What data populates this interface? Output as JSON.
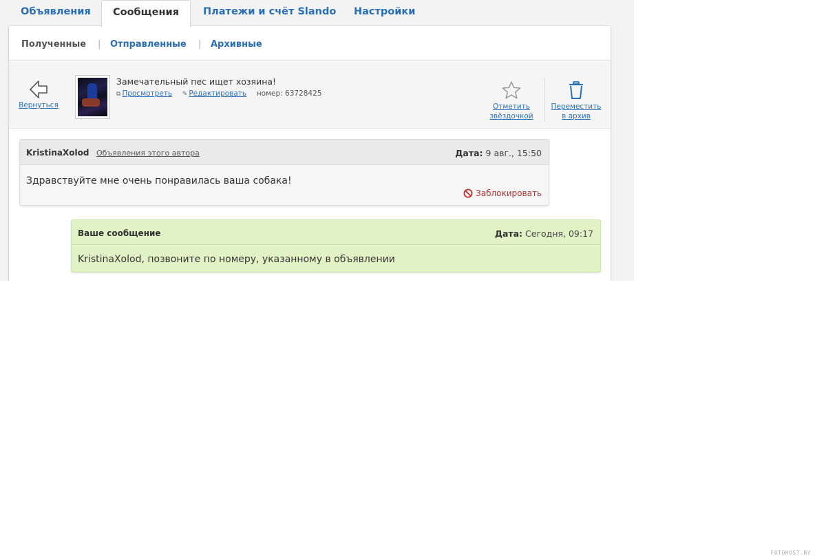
{
  "tabs": [
    {
      "label": "Объявления"
    },
    {
      "label": "Сообщения"
    },
    {
      "label": "Платежи и счёт Slando"
    },
    {
      "label": "Настройки"
    }
  ],
  "subnav": {
    "received": "Полученные",
    "sent": "Отправленные",
    "archived": "Архивные",
    "separator": "|"
  },
  "ad": {
    "back_label": "Вернуться",
    "title": "Замечательный пес ищет хозяина!",
    "view_label": "Просмотреть",
    "edit_label": "Редактировать",
    "number_text": "номер: 63728425",
    "star_label_1": "Отметить",
    "star_label_2": "звёздочкой",
    "archive_label_1": "Переместить",
    "archive_label_2": "в архив"
  },
  "messages": {
    "incoming": {
      "author": "KristinaXolod",
      "author_ads_link": "Объявления этого автора",
      "date_label": "Дата:",
      "date_value": "9 авг., 15:50",
      "text": "Здравствуйте мне очень понравилась ваша собака!",
      "block_label": "Заблокировать"
    },
    "outgoing": {
      "author": "Ваше сообщение",
      "date_label": "Дата:",
      "date_value": "Сегодня, 09:17",
      "text": "KristinaXolod, позвоните по номеру, указанному в объявлении"
    }
  },
  "watermark": "FOTOHOST.BY",
  "colors": {
    "link": "#2a6fb6",
    "outgoing_bg": "#e1f2c5",
    "block_red": "#b03030"
  }
}
